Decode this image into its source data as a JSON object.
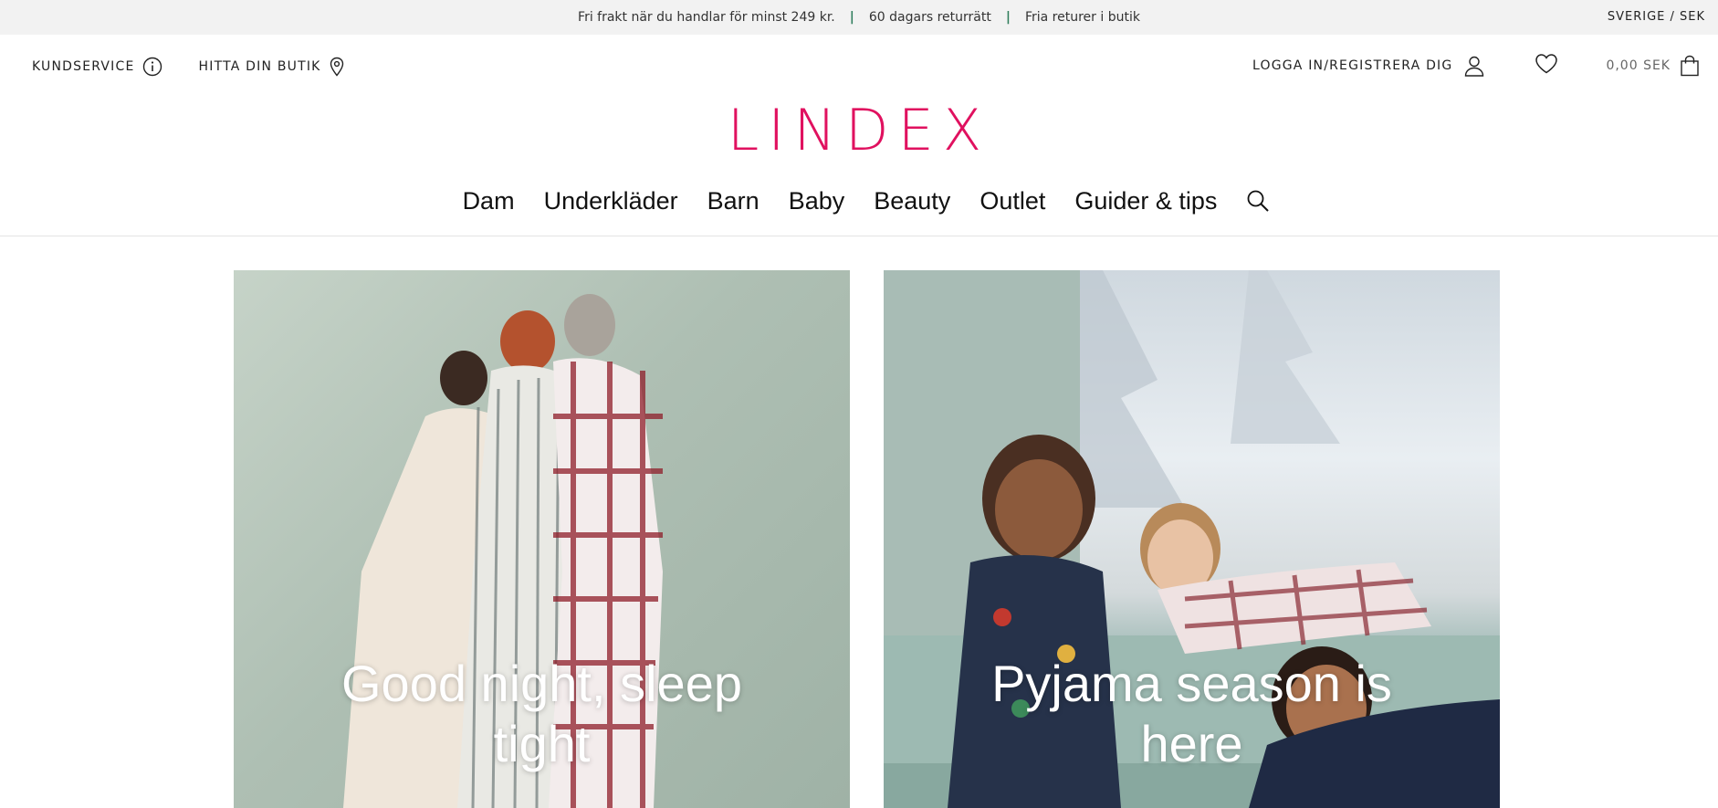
{
  "promo": {
    "items": [
      "Fri frakt när du handlar för minst 249 kr.",
      "60 dagars returrätt",
      "Fria returer i butik"
    ],
    "separator": "|",
    "region": "SVERIGE / SEK"
  },
  "utility": {
    "customer_service": "KUNDSERVICE",
    "find_store": "HITTA DIN BUTIK",
    "login": "LOGGA IN/REGISTRERA DIG",
    "cart_total": "0,00 SEK"
  },
  "brand": {
    "logo": "LINDEX",
    "color": "#e0115f"
  },
  "nav": {
    "items": [
      "Dam",
      "Underkläder",
      "Barn",
      "Baby",
      "Beauty",
      "Outlet",
      "Guider & tips"
    ]
  },
  "hero": {
    "tiles": [
      {
        "caption": "Good night, sleep tight"
      },
      {
        "caption": "Pyjama season is here"
      }
    ]
  },
  "icons": [
    "info-icon",
    "location-pin-icon",
    "user-icon",
    "heart-icon",
    "shopping-bag-icon",
    "search-icon"
  ]
}
